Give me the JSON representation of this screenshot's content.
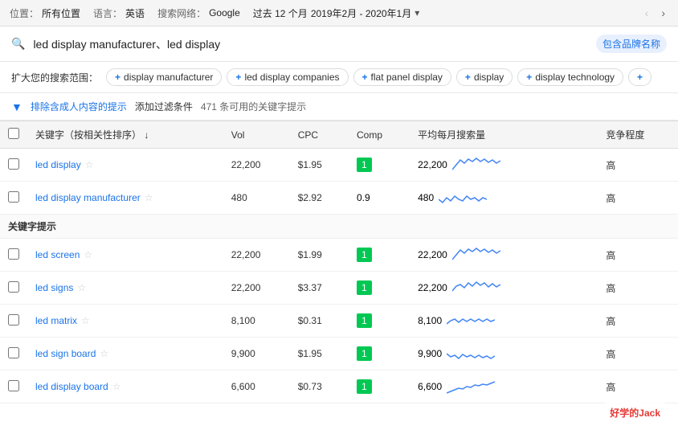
{
  "toolbar": {
    "location_label": "位置：",
    "location_value": "所有位置",
    "language_label": "语言：",
    "language_value": "英语",
    "network_label": "搜索网络：",
    "network_value": "Google",
    "period_label": "过去 12 个月",
    "date_range": "2019年2月 - 2020年1月"
  },
  "search": {
    "query": "led display manufacturer、led display",
    "brand_badge": "包含品牌名称"
  },
  "suggestions": {
    "label": "扩大您的搜索范围：",
    "chips": [
      "display manufacturer",
      "led display companies",
      "flat panel display",
      "display",
      "display technology",
      "+"
    ]
  },
  "filter": {
    "icon": "▼",
    "link_text": "排除含成人内容的提示",
    "add_filter": "添加过滤条件",
    "count_text": "471 条可用的关键字提示"
  },
  "table": {
    "columns": [
      "关键字（按相关性排序）",
      "↓",
      "Vol",
      "CPC",
      "Comp",
      "平均每月搜索量",
      "竞争程度"
    ],
    "section1": {
      "rows": [
        {
          "keyword": "led display",
          "starred": false,
          "vol": "22,200",
          "cpc": "$1.95",
          "comp": "1",
          "comp_green": true,
          "monthly_vol": "22,200",
          "level": "高",
          "sparkline_type": "wavy_high"
        },
        {
          "keyword": "led display manufacturer",
          "starred": false,
          "vol": "480",
          "cpc": "$2.92",
          "comp": "0.9",
          "comp_green": false,
          "monthly_vol": "480",
          "level": "高",
          "sparkline_type": "wavy_mid"
        }
      ]
    },
    "section2_label": "关键字提示",
    "section2": {
      "rows": [
        {
          "keyword": "led screen",
          "starred": false,
          "vol": "22,200",
          "cpc": "$1.99",
          "comp": "1",
          "comp_green": true,
          "monthly_vol": "22,200",
          "level": "高",
          "sparkline_type": "wavy_high"
        },
        {
          "keyword": "led signs",
          "starred": false,
          "vol": "22,200",
          "cpc": "$3.37",
          "comp": "1",
          "comp_green": true,
          "monthly_vol": "22,200",
          "level": "高",
          "sparkline_type": "wavy_high2"
        },
        {
          "keyword": "led matrix",
          "starred": false,
          "vol": "8,100",
          "cpc": "$0.31",
          "comp": "1",
          "comp_green": true,
          "monthly_vol": "8,100",
          "level": "高",
          "sparkline_type": "wavy_mid2"
        },
        {
          "keyword": "led sign board",
          "starred": false,
          "vol": "9,900",
          "cpc": "$1.95",
          "comp": "1",
          "comp_green": true,
          "monthly_vol": "9,900",
          "level": "高",
          "sparkline_type": "wavy_low"
        },
        {
          "keyword": "led display board",
          "starred": false,
          "vol": "6,600",
          "cpc": "$0.73",
          "comp": "1",
          "comp_green": true,
          "monthly_vol": "6,600",
          "level": "高",
          "sparkline_type": "wavy_up"
        }
      ]
    }
  },
  "watermark": {
    "prefix": "好学的",
    "suffix": "Jack"
  }
}
